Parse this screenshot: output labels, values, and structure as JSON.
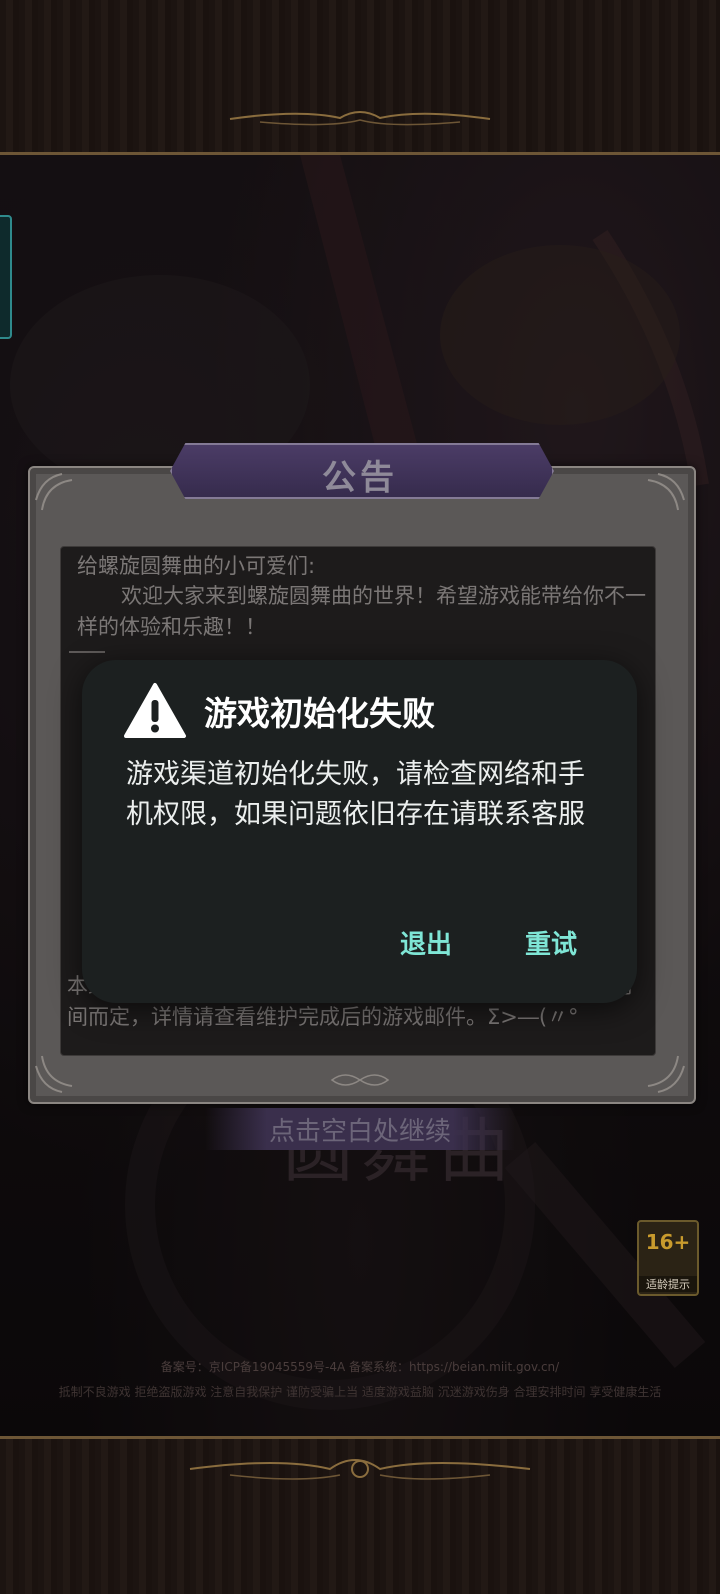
{
  "notice": {
    "title": "公告",
    "greeting": "给螺旋圆舞曲的小可爱们:",
    "welcome": "欢迎大家来到螺旋圆舞曲的世界！希望游戏能带给你不一样的体验和乐趣！！",
    "bottom_text": "本维护会根据维护进度的情况而定，具体时间以维护的实际时间而定，详情请查看维护完成后的游戏邮件。Σ>―(〃°",
    "continue_label": "点击空白处继续"
  },
  "dialog": {
    "title": "游戏初始化失败",
    "message": "游戏渠道初始化失败，请检查网络和手机权限，如果问题依旧存在请联系客服",
    "exit_label": "退出",
    "retry_label": "重试",
    "warning_icon": "warning-triangle-icon"
  },
  "scene": {
    "logo_text": "圆舞曲",
    "age_rating": "16+",
    "age_tip": "适龄提示",
    "icp": "备案号：京ICP备19045559号-4A    备案系统：https://beian.miit.gov.cn/",
    "slogan": "抵制不良游戏  拒绝盗版游戏  注意自我保护  谨防受骗上当  适度游戏益脑  沉迷游戏伤身  合理安排时间  享受健康生活"
  },
  "colors": {
    "dialog_bg": "#1c2020",
    "button_accent": "#7fe6d6",
    "notice_title_bg": "#4b3c66",
    "frame_gold": "#6d5636"
  }
}
